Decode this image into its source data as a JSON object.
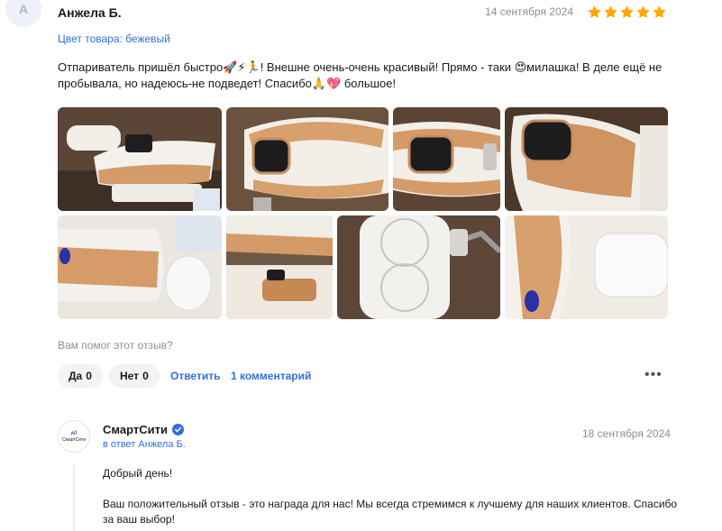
{
  "review": {
    "avatar_letter": "А",
    "author": "Анжела Б.",
    "date": "14 сентября 2024",
    "rating": 5,
    "color_line": "Цвет товара: бежевый",
    "text": "Отпариватель пришёл быстро🚀⚡🏃! Внешне очень-очень красивый! Прямо - таки 😍милашка! В деле ещё не пробывала, но надеюсь-не подведет! Спасибо🙏💖 большое!"
  },
  "actions": {
    "helpful_question": "Вам помог этот отзыв?",
    "yes_label": "Да",
    "yes_count": "0",
    "no_label": "Нет",
    "no_count": "0",
    "reply_label": "Ответить",
    "comments_label": "1 комментарий",
    "more_label": "•••"
  },
  "seller": {
    "logo_mark": "ʌ/\\",
    "logo_name": "СмартСити",
    "name": "СмартСити",
    "reply_to": "в ответ Анжела Б.",
    "date": "18 сентября 2024",
    "greeting": "Добрый день!",
    "message": "Ваш положительный отзыв - это награда для нас! Мы всегда стремимся к лучшему для наших клиентов. Спасибо за ваш выбор!"
  },
  "icons": {
    "star": "star-icon",
    "verified": "verified-check-icon"
  },
  "colors": {
    "star": "#ffa800",
    "link": "#2f6fe0",
    "verified": "#2f6fe0"
  }
}
